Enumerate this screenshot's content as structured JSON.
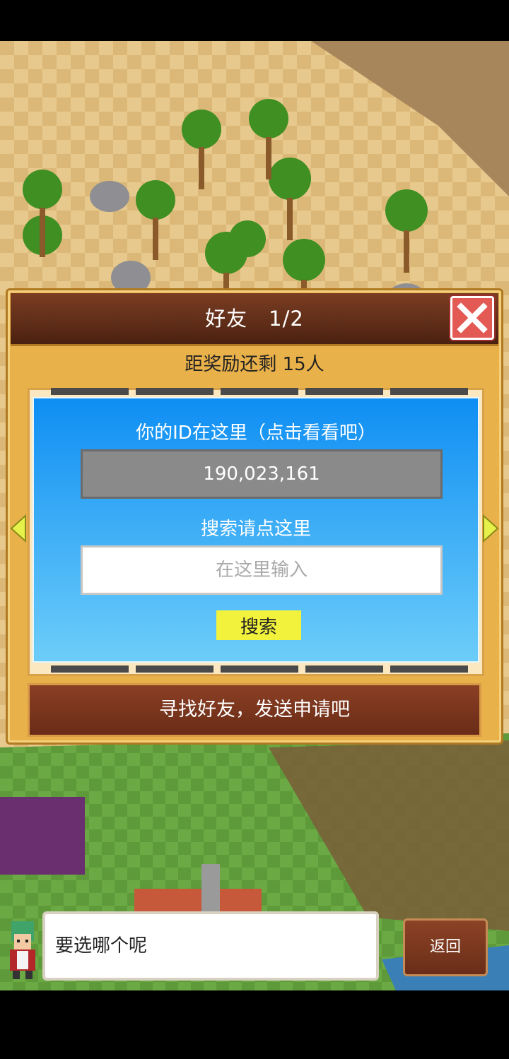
{
  "dialog": {
    "title": "好友　1/2",
    "reward_text": "距奖励还剩 15人",
    "id_label": "你的ID在这里（点击看看吧）",
    "id_value": "190,023,161",
    "search_label": "搜索请点这里",
    "search_placeholder": "在这里输入",
    "search_button": "搜索",
    "find_friends_button": "寻找好友，发送申请吧"
  },
  "chat": {
    "speech_text": "要选哪个呢",
    "back_button": "返回"
  },
  "icons": {
    "close": "close-icon",
    "prev": "arrow-left-icon",
    "next": "arrow-right-icon"
  },
  "colors": {
    "panel_blue": "#1e9cf4",
    "dialog_gold": "#e9b14a",
    "header_brown": "#6b331c",
    "search_button_yellow": "#f2f23c",
    "close_red": "#e35a55"
  }
}
